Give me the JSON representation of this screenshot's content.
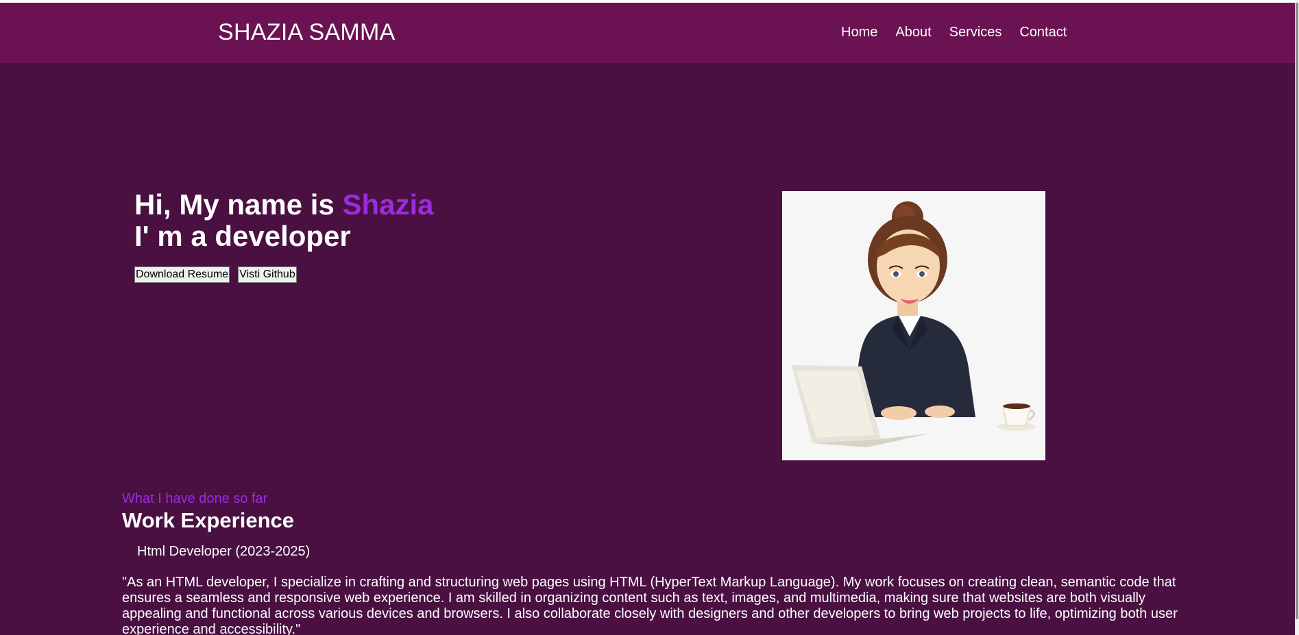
{
  "header": {
    "brand": "SHAZIA SAMMA",
    "nav": [
      "Home",
      "About",
      "Services",
      "Contact"
    ]
  },
  "hero": {
    "greeting_prefix": "Hi, My name is ",
    "greeting_name": "Shazia",
    "role_line": "I' m a developer",
    "buttons": {
      "resume": "Download Resume",
      "github": "Visti Github"
    },
    "image_icon": "illustration-woman-with-laptop"
  },
  "experience": {
    "subtitle": "What I have done so far",
    "title": "Work Experience",
    "job_title": "Html Developer (2023-2025)",
    "job_description": "\"As an HTML developer, I specialize in crafting and structuring web pages using HTML (HyperText Markup Language). My work focuses on creating clean, semantic code that ensures a seamless and responsive web experience. I am skilled in organizing content such as text, images, and multimedia, making sure that websites are both visually appealing and functional across various devices and browsers. I also collaborate closely with designers and other developers to bring web projects to life, optimizing both user experience and accessibility.\""
  },
  "colors": {
    "header_bg": "#6b1252",
    "page_bg": "#4a1042",
    "accent": "#9b2be0",
    "text": "#ffffff"
  }
}
